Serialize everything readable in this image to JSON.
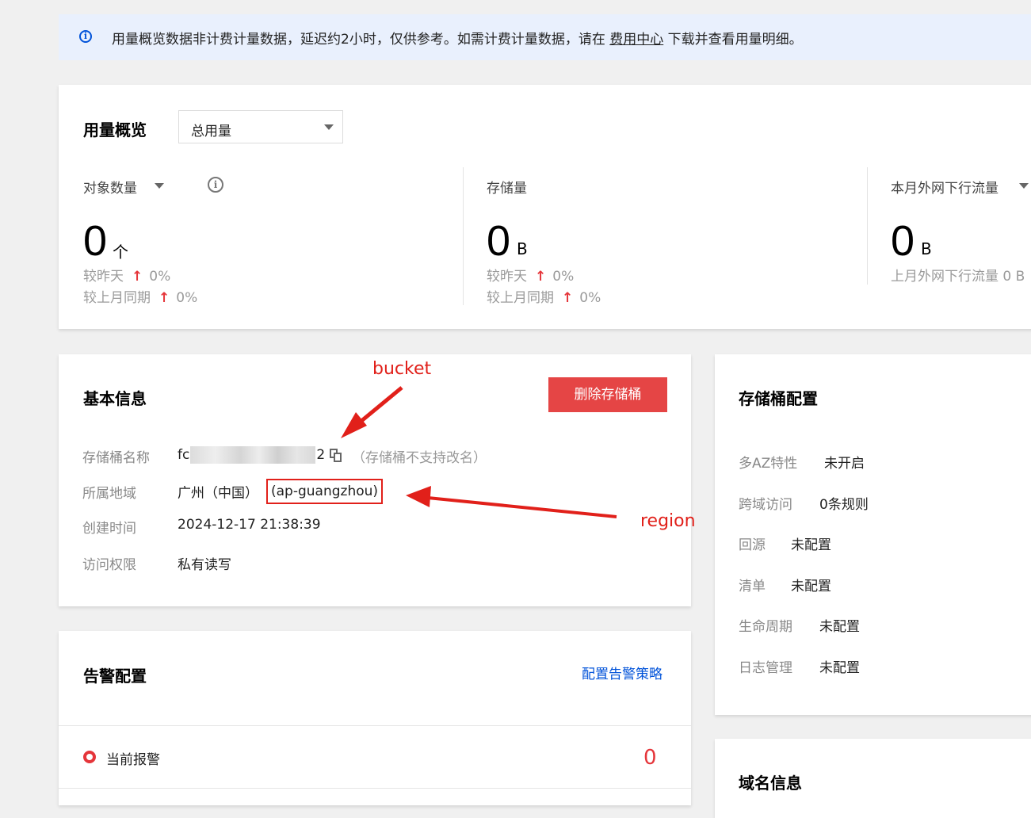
{
  "notice": {
    "text_before": "用量概览数据非计费计量数据，延迟约2小时，仅供参考。如需计费计量数据，请在 ",
    "link": "费用中心",
    "text_after": " 下载并查看用量明细。",
    "icon": "info-circle-icon"
  },
  "usage": {
    "title": "用量概览",
    "select_value": "总用量",
    "metrics": [
      {
        "label": "对象数量",
        "value": "0",
        "unit": "个",
        "compare_day_label": "较昨天",
        "compare_day": "0%",
        "compare_month_label": "较上月同期",
        "compare_month": "0%"
      },
      {
        "label": "存储量",
        "value": "0",
        "unit": "B",
        "compare_day_label": "较昨天",
        "compare_day": "0%",
        "compare_month_label": "较上月同期",
        "compare_month": "0%"
      },
      {
        "label": "本月外网下行流量",
        "value": "0",
        "unit": "B",
        "last_month": "上月外网下行流量 0 B"
      }
    ],
    "up_arrow": "↑"
  },
  "basic": {
    "title": "基本信息",
    "delete_button": "删除存储桶",
    "rows": [
      {
        "label": "存储桶名称",
        "value_prefix": "fc",
        "value_suffix": "2",
        "hint": "（存储桶不支持改名）"
      },
      {
        "label": "所属地域",
        "value": "广州（中国）",
        "region": "(ap-guangzhou)"
      },
      {
        "label": "创建时间",
        "value": "2024-12-17 21:38:39"
      },
      {
        "label": "访问权限",
        "value": "私有读写"
      }
    ]
  },
  "alert": {
    "title": "告警配置",
    "link": "配置告警策略",
    "current_label": "当前报警",
    "current_count": "0"
  },
  "bucket_config": {
    "title": "存储桶配置",
    "rows": [
      {
        "label": "多AZ特性",
        "value": "未开启"
      },
      {
        "label": "跨域访问",
        "value": "0条规则"
      },
      {
        "label": "回源",
        "value": "未配置"
      },
      {
        "label": "清单",
        "value": "未配置"
      },
      {
        "label": "生命周期",
        "value": "未配置"
      },
      {
        "label": "日志管理",
        "value": "未配置"
      }
    ]
  },
  "domain": {
    "title": "域名信息"
  },
  "annotations": {
    "bucket": "bucket",
    "region": "region",
    "color": "#e1201a"
  }
}
